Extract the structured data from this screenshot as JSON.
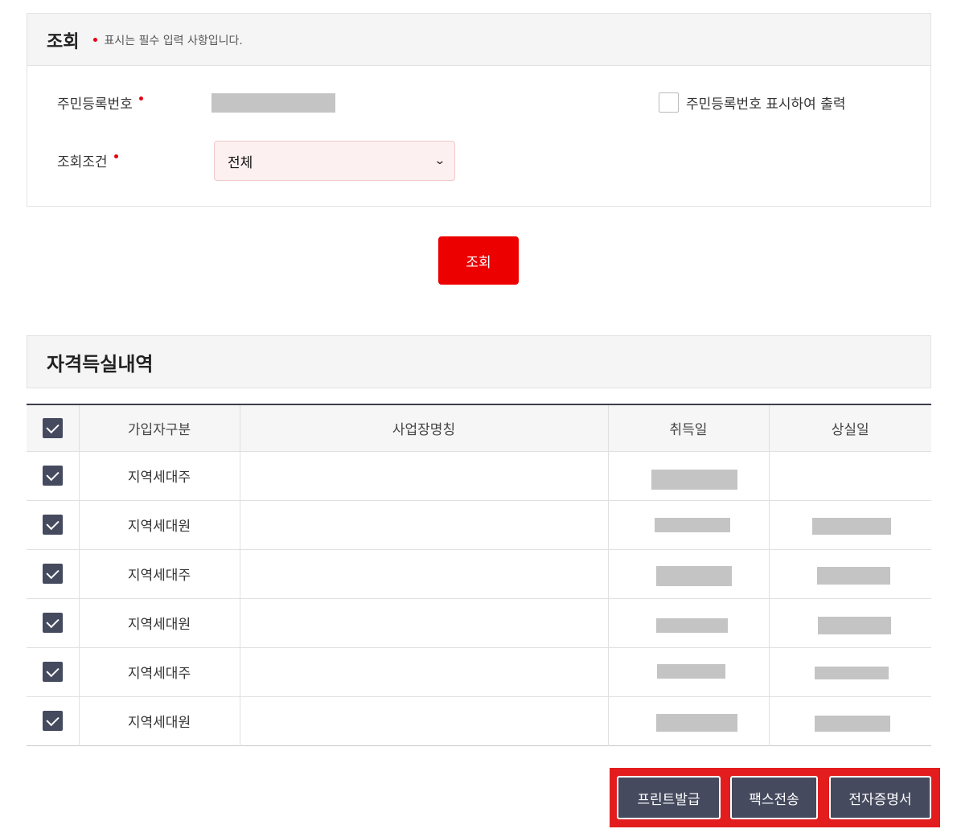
{
  "query": {
    "title": "조회",
    "required_note": "표시는 필수 입력 사항입니다.",
    "resident_number_label": "주민등록번호",
    "show_resident_number_label": "주민등록번호 표시하여 출력",
    "condition_label": "조회조건",
    "condition_selected": "전체",
    "search_button": "조회"
  },
  "history": {
    "title": "자격득실내역",
    "columns": [
      "가입자구분",
      "사업장명칭",
      "취득일",
      "상실일"
    ],
    "rows": [
      {
        "type": "지역세대주",
        "workplace": "",
        "acquired": "",
        "lost": ""
      },
      {
        "type": "지역세대원",
        "workplace": "",
        "acquired": "",
        "lost": ""
      },
      {
        "type": "지역세대주",
        "workplace": "",
        "acquired": "",
        "lost": ""
      },
      {
        "type": "지역세대원",
        "workplace": "",
        "acquired": "",
        "lost": ""
      },
      {
        "type": "지역세대주",
        "workplace": "",
        "acquired": "",
        "lost": ""
      },
      {
        "type": "지역세대원",
        "workplace": "",
        "acquired": "",
        "lost": ""
      }
    ]
  },
  "actions": {
    "print": "프린트발급",
    "fax": "팩스전송",
    "ecert": "전자증명서"
  },
  "colors": {
    "accent_red": "#ec0000",
    "button_dark": "#454a5e",
    "highlight_red": "#e31d1d"
  }
}
